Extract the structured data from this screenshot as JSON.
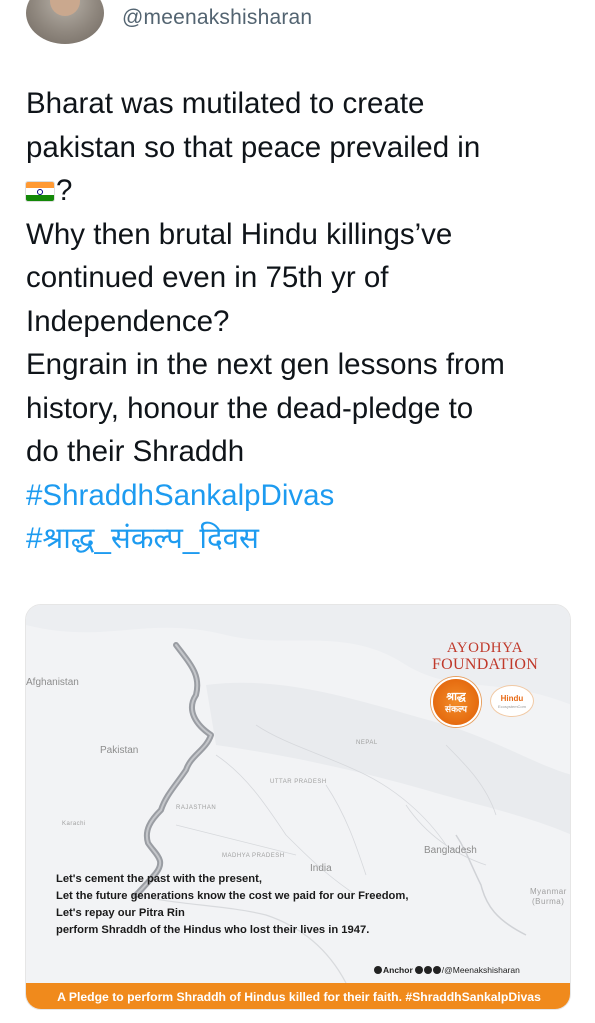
{
  "header": {
    "handle": "@meenakshisharan"
  },
  "tweet": {
    "line1": "Bharat was mutilated to create",
    "line2": "pakistan so that peace prevailed in",
    "line3_suffix": "?",
    "flag_icon": "india-flag-emoji",
    "line4": "Why then brutal Hindu killings’ve",
    "line5": "continued even in 75th yr of",
    "line6": "Independence?",
    "line7": "Engrain in the next gen lessons from",
    "line8": "history, honour the dead-pledge to",
    "line9": "do their Shraddh",
    "hashtag1": "#ShraddhSankalpDivas",
    "hashtag2": "#श्राद्ध_संकल्प_दिवस",
    "hashtag_color": "#1d9bf0"
  },
  "media": {
    "map_labels": {
      "afghanistan": "Afghanistan",
      "pakistan": "Pakistan",
      "bangladesh": "Bangladesh",
      "myanmar": "Myanmar",
      "burma": "(Burma)",
      "india": "India",
      "nepal": "NEPAL",
      "rajasthan": "RAJASTHAN",
      "karachi": "Karachi",
      "uttar_pradesh": "UTTAR PRADESH",
      "madhya_pradesh": "MADHYA PRADESH"
    },
    "logo": {
      "ayodhya_top": "AYODHYA",
      "ayodhya_bottom": "FOUNDATION",
      "circle_text_1": "श्राद्ध",
      "circle_text_2": "संकल्प",
      "hindu_text": "Hindu",
      "hindu_sub": "EcosystemCom"
    },
    "pledge": {
      "line1": "Let's cement the past with the present,",
      "line2": "Let the future generations know the cost we paid for our Freedom,",
      "line3": "Let's repay our Pitra Rin",
      "line4": "perform Shraddh of the Hindus who lost their lives in 1947."
    },
    "credits": {
      "anchor": "Anchor",
      "handle": "/@Meenakshisharan"
    },
    "banner": "A Pledge to perform Shraddh of Hindus killed for their faith. #ShraddhSankalpDivas",
    "banner_color": "#f08a1c"
  }
}
